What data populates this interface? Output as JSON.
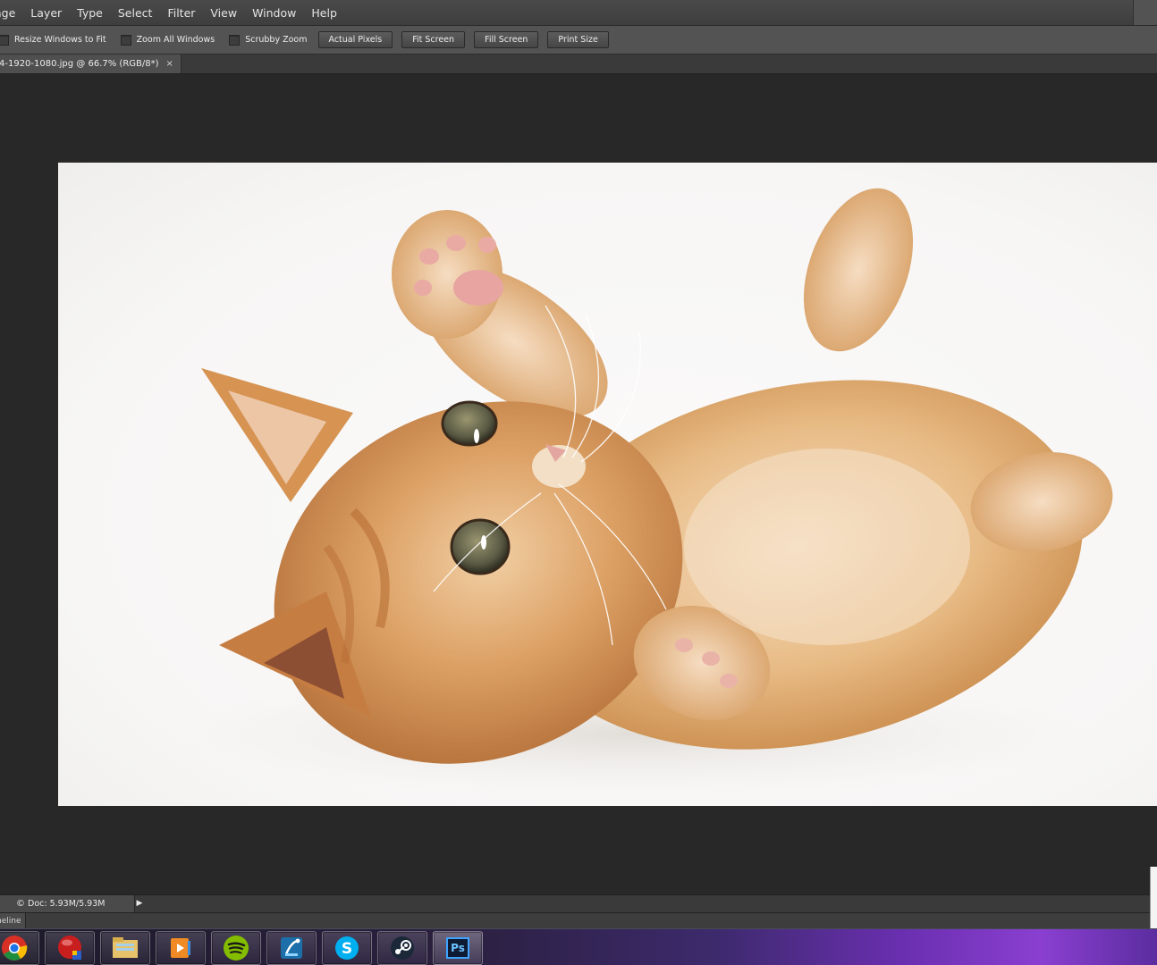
{
  "menubar": {
    "items": [
      "age",
      "Layer",
      "Type",
      "Select",
      "Filter",
      "View",
      "Window",
      "Help"
    ]
  },
  "options": {
    "checkboxes": [
      "Resize Windows to Fit",
      "Zoom All Windows",
      "Scrubby Zoom"
    ],
    "buttons": [
      "Actual Pixels",
      "Fit Screen",
      "Fill Screen",
      "Print Size"
    ]
  },
  "document_tab": {
    "title": "4-1920-1080.jpg @ 66.7% (RGB/8*)",
    "close": "×"
  },
  "statusbar": {
    "copyright_symbol": "©",
    "doc_size": "Doc: 5.93M/5.93M",
    "arrow": "▶"
  },
  "timeline": {
    "tab_label": "neline"
  },
  "taskbar": {
    "apps": [
      {
        "name": "chrome-icon"
      },
      {
        "name": "record-app-icon"
      },
      {
        "name": "file-explorer-icon"
      },
      {
        "name": "media-player-icon"
      },
      {
        "name": "spotify-icon"
      },
      {
        "name": "app-launcher-icon"
      },
      {
        "name": "skype-icon",
        "glyph": "S"
      },
      {
        "name": "steam-icon"
      },
      {
        "name": "photoshop-icon",
        "glyph": "Ps"
      }
    ]
  },
  "colors": {
    "menubar": "#444444",
    "optionsbar": "#535353",
    "canvas": "#282828",
    "image_background": "#f8f7f6",
    "kitten_fur": "#e0a86a"
  }
}
